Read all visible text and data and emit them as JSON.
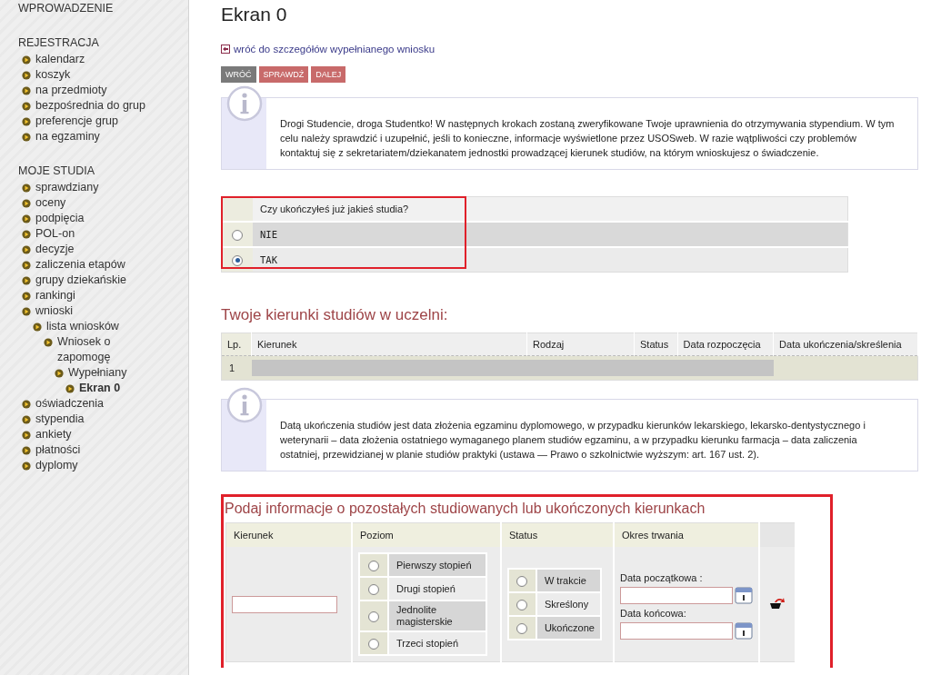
{
  "sidebar": {
    "sections": [
      {
        "title": "WPROWADZENIE"
      },
      {
        "title": "REJESTRACJA",
        "items": [
          {
            "label": "kalendarz",
            "selected": false
          },
          {
            "label": "koszyk",
            "selected": false
          },
          {
            "label": "na przedmioty",
            "selected": false
          },
          {
            "label": "bezpośrednia do grup",
            "selected": false
          },
          {
            "label": "preferencje grup",
            "selected": false
          },
          {
            "label": "na egzaminy",
            "selected": false
          }
        ]
      },
      {
        "title": "MOJE STUDIA",
        "items": [
          {
            "label": "sprawdziany",
            "selected": false
          },
          {
            "label": "oceny",
            "selected": false
          },
          {
            "label": "podpięcia",
            "selected": false
          },
          {
            "label": "POL-on",
            "selected": false
          },
          {
            "label": "decyzje",
            "selected": false
          },
          {
            "label": "zaliczenia etapów",
            "selected": false
          },
          {
            "label": "grupy dziekańskie",
            "selected": false
          },
          {
            "label": "rankingi",
            "selected": false
          },
          {
            "label": "wnioski",
            "selected": false,
            "children": [
              {
                "label": "lista wniosków",
                "selected": false,
                "children": [
                  {
                    "label": "Wniosek o zapomogę",
                    "selected": false,
                    "children": [
                      {
                        "label": "Wypełniany",
                        "selected": false,
                        "children": [
                          {
                            "label": "Ekran 0",
                            "selected": true
                          }
                        ]
                      }
                    ]
                  }
                ]
              }
            ]
          },
          {
            "label": "oświadczenia",
            "selected": false
          },
          {
            "label": "stypendia",
            "selected": false
          },
          {
            "label": "ankiety",
            "selected": false
          },
          {
            "label": "płatności",
            "selected": false
          },
          {
            "label": "dyplomy",
            "selected": false
          }
        ]
      }
    ]
  },
  "page": {
    "title": "Ekran 0",
    "back_link": "wróć do szczegółów wypełnianego wniosku",
    "buttons": [
      {
        "label": "WRÓĆ",
        "kind": "neutral"
      },
      {
        "label": "SPRAWDŹ",
        "kind": "action"
      },
      {
        "label": "DALEJ",
        "kind": "action"
      }
    ]
  },
  "info_1": "Drogi Studencie, droga Studentko! W następnych krokach zostaną zweryfikowane Twoje uprawnienia do otrzymywania stypendium. W tym celu należy sprawdzić i uzupełnić, jeśli to konieczne, informacje wyświetlone przez USOSweb. W razie wątpliwości czy problemów kontaktuj się z sekretariatem/dziekanatem jednostki prowadzącej kierunek studiów, na którym wnioskujesz o świadczenie.",
  "question": {
    "label": "Czy ukończyłeś już jakieś studia?",
    "options": [
      {
        "label": "NIE",
        "selected": false
      },
      {
        "label": "TAK",
        "selected": true
      }
    ]
  },
  "programs": {
    "title": "Twoje kierunki studiów w uczelni:",
    "columns": [
      "Lp.",
      "Kierunek",
      "Rodzaj",
      "Status",
      "Data rozpoczęcia",
      "Data ukończenia/skreślenia"
    ],
    "rows": [
      {
        "lp": "1"
      }
    ]
  },
  "info_2": "Datą ukończenia studiów jest data złożenia egzaminu dyplomowego, w przypadku kierunków lekarskiego, lekarsko-dentystycznego i weterynarii – data złożenia ostatniego wymaganego planem studiów egzaminu, a w przypadku kierunku farmacja – data zaliczenia ostatniej, przewidzianej w planie studiów praktyki (ustawa — Prawo o szkolnictwie wyższym: art. 167 ust. 2).",
  "other_programs": {
    "title": "Podaj informacje o pozostałych studiowanych lub ukończonych kierunkach",
    "columns": [
      "Kierunek",
      "Poziom",
      "Status",
      "Okres trwania"
    ],
    "levels": [
      {
        "label": "Pierwszy stopień",
        "selected": false
      },
      {
        "label": "Drugi stopień",
        "selected": false
      },
      {
        "label": "Jednolite magisterskie",
        "selected": false
      },
      {
        "label": "Trzeci stopień",
        "selected": false
      }
    ],
    "statuses": [
      {
        "label": "W trakcie",
        "selected": false
      },
      {
        "label": "Skreślony",
        "selected": false
      },
      {
        "label": "Ukończone",
        "selected": false
      }
    ],
    "start_label": "Data początkowa :",
    "end_label": "Data końcowa:"
  }
}
